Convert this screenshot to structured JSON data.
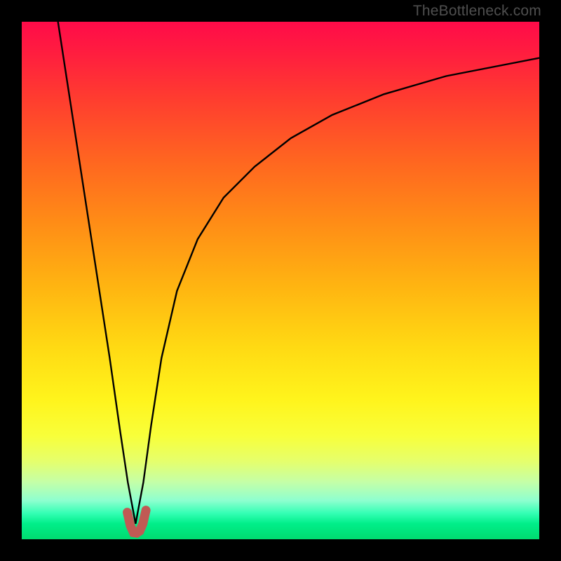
{
  "watermark": {
    "text": "TheBottleneck.com"
  },
  "chart_data": {
    "type": "line",
    "title": "",
    "xlabel": "",
    "ylabel": "",
    "xlim": [
      0,
      100
    ],
    "ylim": [
      0,
      100
    ],
    "grid": false,
    "notes": "Background is a vertical gradient: top ≈ red/magenta, middle ≈ orange/yellow, bottom ≈ thin green band. The black curve is a V-shaped bottleneck curve with its minimum (best match) at roughly x ≈ 22 where y ≈ 0–4. A short thick muted-red highlight marks the basin around the minimum.",
    "series": [
      {
        "name": "bottleneck-curve",
        "stroke": "#000000",
        "x": [
          7,
          9,
          11,
          13,
          15,
          17,
          19,
          20.5,
          22,
          23.5,
          25,
          27,
          30,
          34,
          39,
          45,
          52,
          60,
          70,
          82,
          100
        ],
        "y": [
          100,
          87,
          74,
          61,
          48,
          35,
          21,
          11,
          3,
          11,
          22,
          35,
          48,
          58,
          66,
          72,
          77.5,
          82,
          86,
          89.5,
          93
        ]
      },
      {
        "name": "basin-highlight",
        "stroke": "#c05a54",
        "stroke_width_px": 13,
        "x": [
          20.4,
          21,
          21.6,
          22.2,
          22.8,
          23.4,
          24.0
        ],
        "y": [
          5.2,
          2.6,
          1.3,
          1.2,
          1.6,
          3.0,
          5.6
        ]
      }
    ],
    "gradient_stops": [
      {
        "pct": 0,
        "color": "#ff0b49"
      },
      {
        "pct": 15,
        "color": "#ff3d2f"
      },
      {
        "pct": 39,
        "color": "#ff8d16"
      },
      {
        "pct": 63,
        "color": "#ffda13"
      },
      {
        "pct": 80,
        "color": "#f8ff3a"
      },
      {
        "pct": 92,
        "color": "#8effcf"
      },
      {
        "pct": 100,
        "color": "#00dc70"
      }
    ]
  }
}
